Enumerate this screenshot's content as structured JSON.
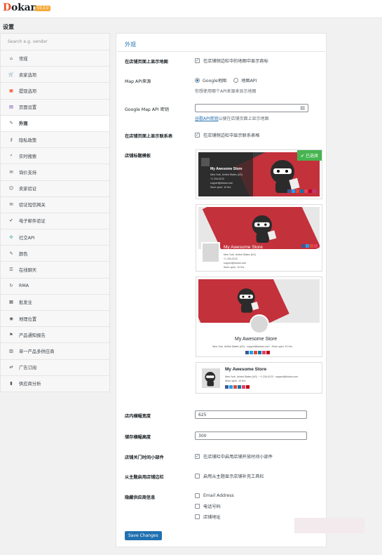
{
  "brand": {
    "name_first": "D",
    "name_rest": "okan",
    "version": "V3.3.9"
  },
  "page_title": "设置",
  "sidebar": {
    "search_placeholder": "Search e.g. vendor",
    "items": [
      {
        "label": "常规",
        "icon": "home-icon"
      },
      {
        "label": "卖家选项",
        "icon": "cart-icon"
      },
      {
        "label": "提现选项",
        "icon": "wallet-icon"
      },
      {
        "label": "页面设置",
        "icon": "page-icon"
      },
      {
        "label": "外观",
        "icon": "brush-icon",
        "active": true
      },
      {
        "label": "隐私政策",
        "icon": "key-icon"
      },
      {
        "label": "实时搜索",
        "icon": "search-icon"
      },
      {
        "label": "询价支持",
        "icon": "chat-icon"
      },
      {
        "label": "卖家验证",
        "icon": "user-check-icon"
      },
      {
        "label": "验证短信网关",
        "icon": "mail-icon"
      },
      {
        "label": "电子邮件验证",
        "icon": "envelope-check-icon"
      },
      {
        "label": "社交API",
        "icon": "network-icon"
      },
      {
        "label": "颜色",
        "icon": "pen-icon"
      },
      {
        "label": "在线聊天",
        "icon": "chat-bubbles-icon"
      },
      {
        "label": "RMA",
        "icon": "refresh-icon"
      },
      {
        "label": "批发业",
        "icon": "boxes-icon"
      },
      {
        "label": "地理位置",
        "icon": "location-icon"
      },
      {
        "label": "产品通知报告",
        "icon": "flag-icon"
      },
      {
        "label": "单一产品多供应商",
        "icon": "store-icon"
      },
      {
        "label": "广告订阅",
        "icon": "repeat-icon"
      },
      {
        "label": "供应商分析",
        "icon": "chart-icon"
      }
    ]
  },
  "main": {
    "section_title": "外观",
    "map": {
      "label": "在店铺页面上显示地图",
      "option": "在店铺侧边栏中的地图中显示商标",
      "checked": true
    },
    "map_api": {
      "label": "Map API来源",
      "opt1": "Google地图",
      "opt2": "地图API",
      "selected": "Google地图",
      "desc": "你想使用哪个API来源来显示地图"
    },
    "google_key": {
      "label": "Google Map API 密钥",
      "value": "",
      "desc_link": "谷歌API密钥",
      "desc_rest": "以便在店铺页面上显示地图"
    },
    "contact": {
      "label": "在店铺页面上显示联系表",
      "option": "在店铺侧边栏中显示联系表格",
      "checked": true
    },
    "header_template": {
      "label": "店铺标题模板",
      "selected_badge": "已选择",
      "store_name": "My Awesome Store",
      "address": "New York, United States (US)",
      "phone": "+1 234-0123",
      "email": "support@dokan.com",
      "hours": "Store open: 10 Hrs"
    },
    "banner_width": {
      "label": "店内横幅宽度",
      "value": "625"
    },
    "banner_height": {
      "label": "储存横幅高度",
      "value": "300"
    },
    "open_close": {
      "label": "店铺关门时间小部件",
      "option": "在店铺栏中启用店铺开放时间小部件",
      "checked": true
    },
    "vendor_sidebar": {
      "label": "从主题启用店铺边栏",
      "option": "启用从主题显示店铺补充工具栏",
      "checked": false
    },
    "hide_vendor": {
      "label": "隐藏供应商信息",
      "opt1": "Email Address",
      "opt2": "电话号码",
      "opt3": "店铺地址"
    },
    "save_label": "Save Changes"
  },
  "colors": {
    "accent": "#2271b1",
    "selected": "#46b450",
    "banner": "#c3313b"
  }
}
